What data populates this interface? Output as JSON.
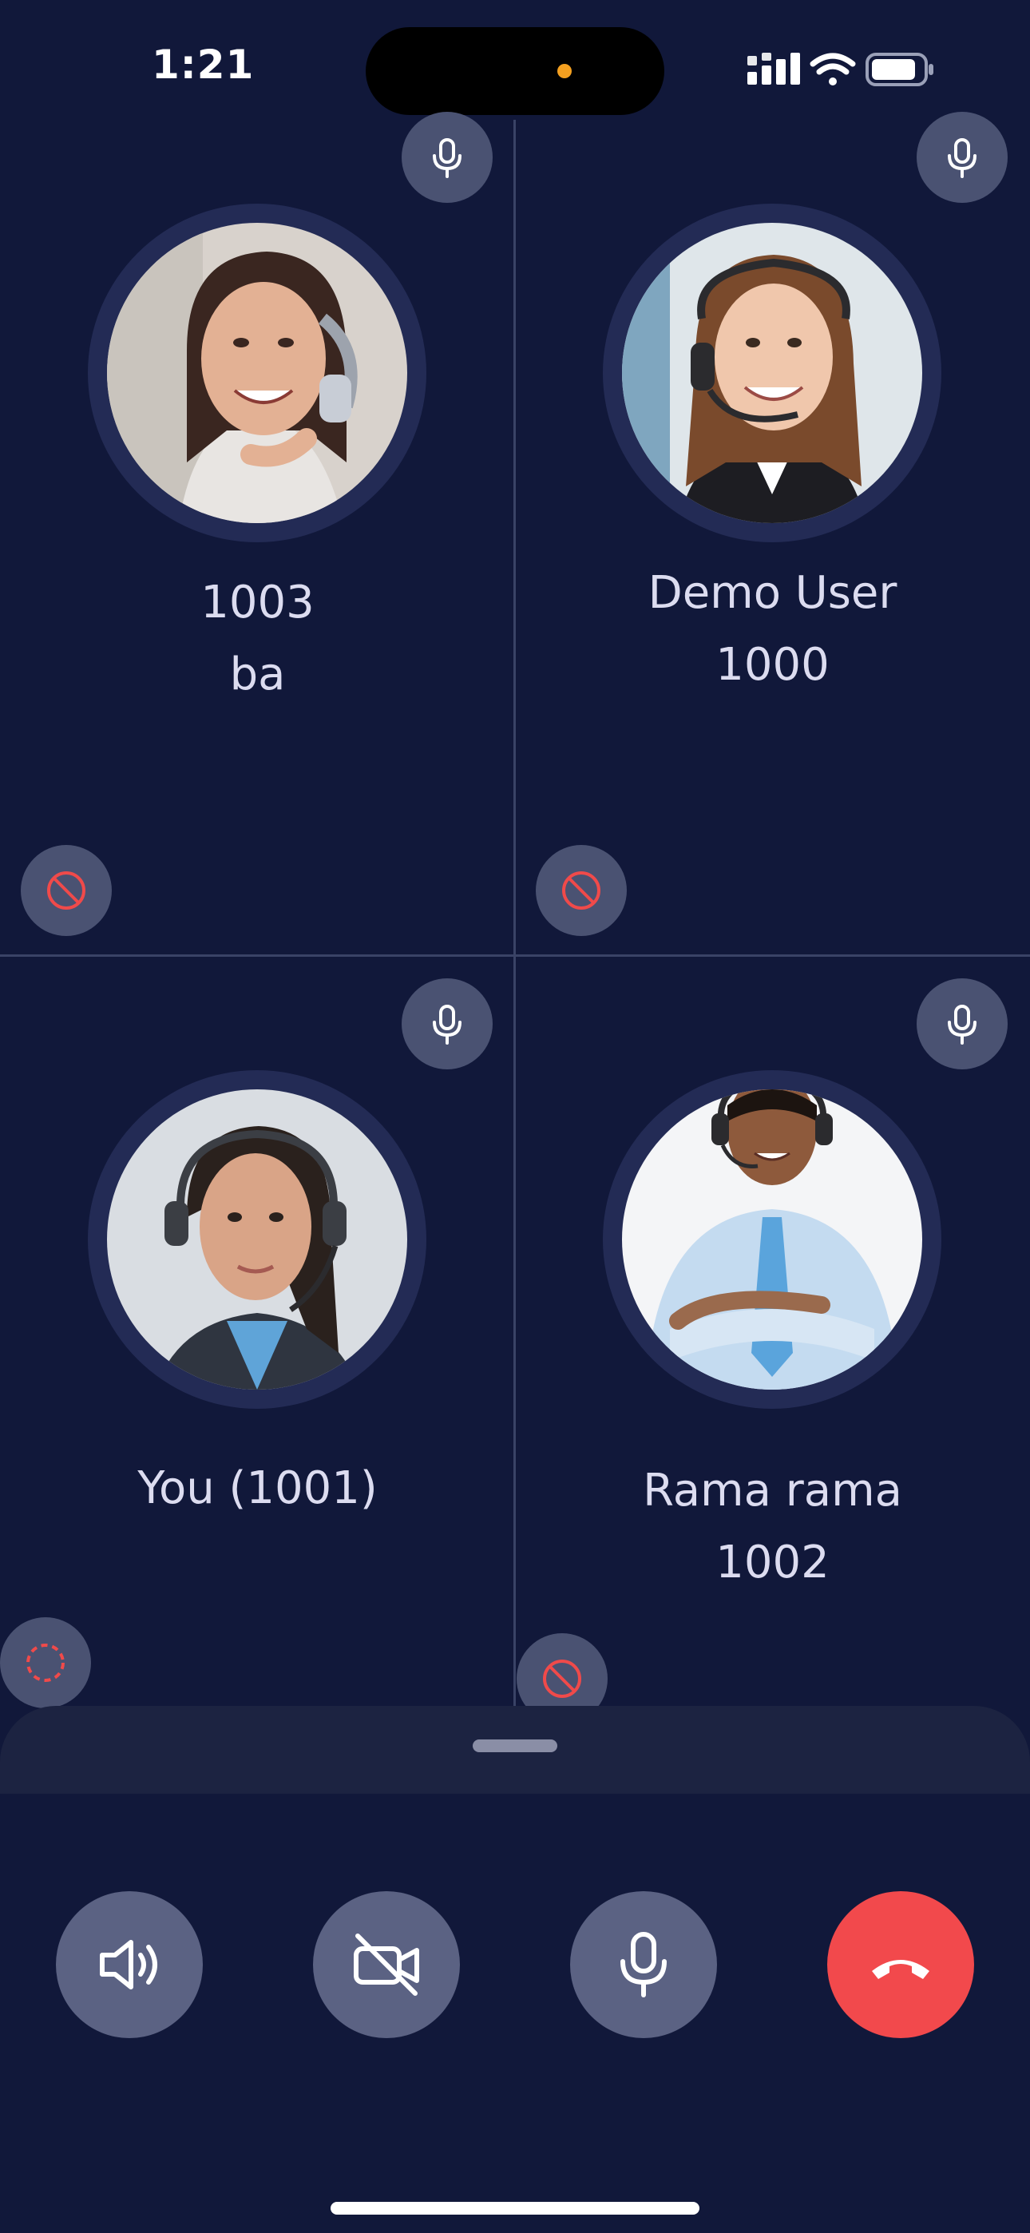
{
  "status_bar": {
    "time": "1:21",
    "icons": [
      "cellular-signal-icon",
      "wifi-icon",
      "battery-icon"
    ]
  },
  "participants": [
    {
      "line1": "1003",
      "line2": "ba",
      "mic_icon": "microphone-icon",
      "video_icon": "video-blocked-icon",
      "video_icon_color": "#f04a4a"
    },
    {
      "line1": "Demo User",
      "line2": "1000",
      "mic_icon": "microphone-icon",
      "video_icon": "video-blocked-icon",
      "video_icon_color": "#f04a4a"
    },
    {
      "line1": "You (1001)",
      "line2": "",
      "mic_icon": "microphone-icon",
      "video_icon": "video-loading-icon",
      "video_icon_color": "#f04a4a"
    },
    {
      "line1": "Rama rama",
      "line2": "1002",
      "mic_icon": "microphone-icon",
      "video_icon": "video-blocked-icon",
      "video_icon_color": "#f04a4a"
    }
  ],
  "controls": [
    {
      "name": "speaker",
      "icon": "speaker-icon"
    },
    {
      "name": "camera",
      "icon": "camera-off-icon"
    },
    {
      "name": "microphone",
      "icon": "microphone-icon"
    },
    {
      "name": "end-call",
      "icon": "end-call-icon",
      "color": "#f2494c"
    }
  ],
  "colors": {
    "background": "#11183a",
    "badge": "#4a5272",
    "control": "#5b6283",
    "end_call": "#f2494c",
    "name_text": "#dcdcf0"
  }
}
